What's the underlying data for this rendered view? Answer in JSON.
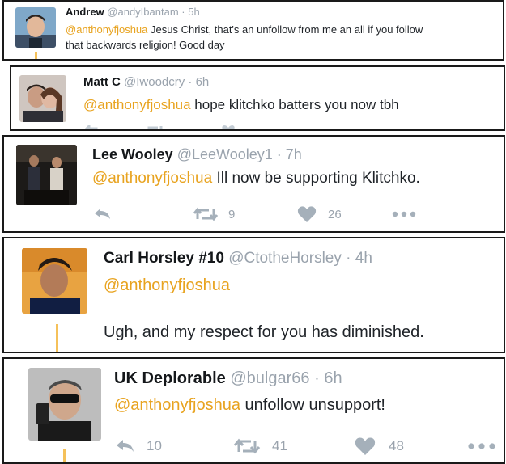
{
  "tweets": [
    {
      "name": "Andrew",
      "handle": "@andyIbantam",
      "sep": "·",
      "time": "5h",
      "mention": "@anthonyfjoshua",
      "text_line1": " Jesus Christ, that's an unfollow from me an all if you follow",
      "text_line2": "that backwards religion! Good day"
    },
    {
      "name": "Matt C",
      "handle": "@Iwoodcry",
      "sep": "·",
      "time": "6h",
      "mention": "@anthonyfjoshua",
      "text": " hope klitchko batters you now tbh"
    },
    {
      "name": "Lee Wooley",
      "handle": "@LeeWooley1",
      "sep": "·",
      "time": "7h",
      "mention": "@anthonyfjoshua",
      "text": " Ill now be supporting Klitchko.",
      "retweets": "9",
      "likes": "26"
    },
    {
      "name": "Carl Horsley #10",
      "handle": "@CtotheHorsley",
      "sep": "·",
      "time": "4h",
      "mention": "@anthonyfjoshua",
      "text": "Ugh, and my respect for you has diminished."
    },
    {
      "name": "UK Deplorable",
      "handle": "@bulgar66",
      "sep": "·",
      "time": "6h",
      "mention": "@anthonyfjoshua",
      "text": " unfollow unsupport!",
      "replies": "10",
      "retweets": "41",
      "likes": "48"
    }
  ],
  "colors": {
    "mention": "#e8a31f",
    "meta": "#9aa3ad",
    "action_icon": "#a5b0ba",
    "thread_line": "#f5c15a",
    "border": "#1a1a1a"
  },
  "icons": [
    "reply-icon",
    "retweet-icon",
    "like-icon",
    "more-icon"
  ]
}
